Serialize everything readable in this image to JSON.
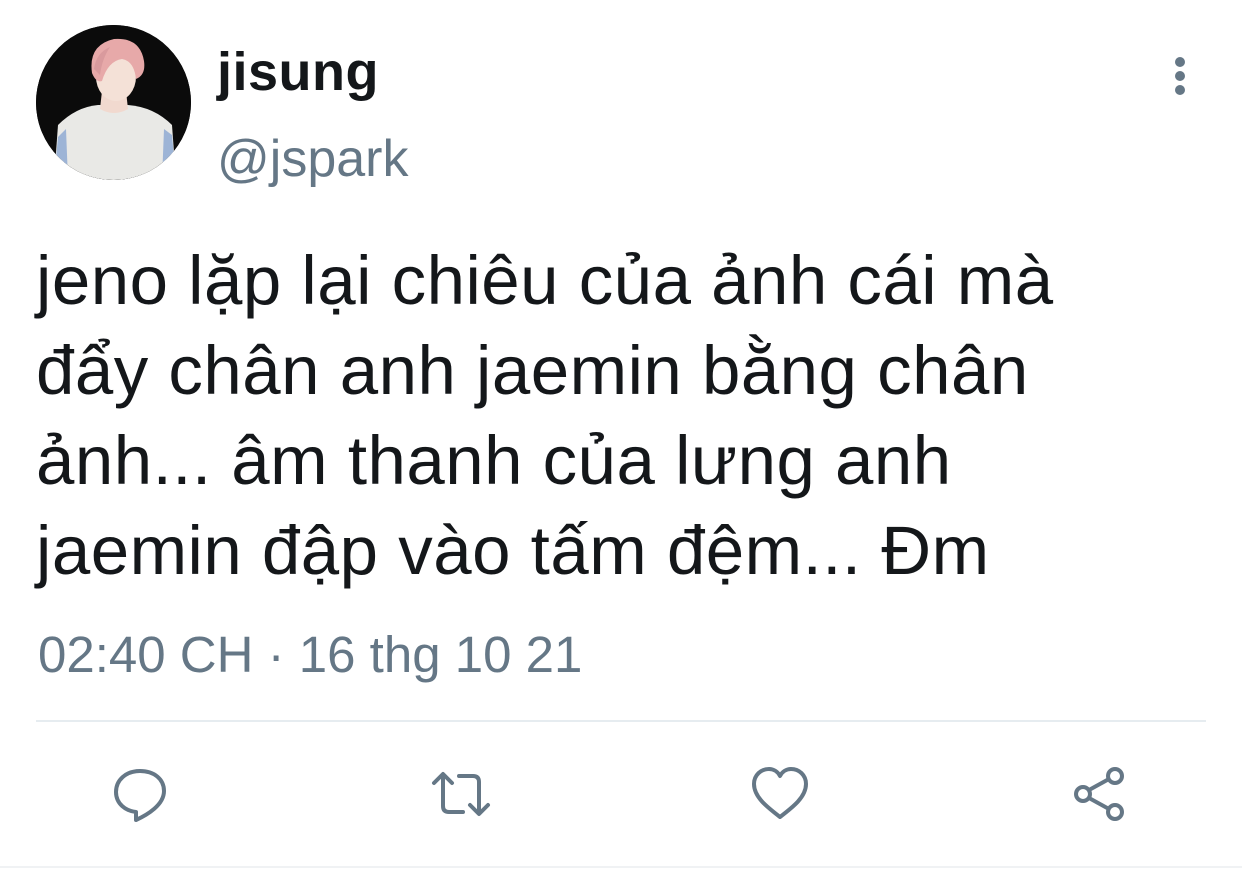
{
  "user": {
    "display_name": "jisung",
    "handle": "@jspark"
  },
  "tweet": {
    "lines": [
      "jeno lặp lại chiêu của ảnh cái mà",
      "đẩy chân anh jaemin bằng chân",
      "ảnh... âm thanh của lưng anh",
      "jaemin đập vào tấm đệm... Đm"
    ],
    "timestamp": "02:40 CH · 16 thg 10 21"
  },
  "icons": {
    "more": "more-vertical-icon",
    "reply": "reply-icon",
    "retweet": "retweet-icon",
    "like": "heart-icon",
    "share": "share-icon"
  },
  "colors": {
    "text": "#14171a",
    "secondary": "#657786",
    "divider": "#e6ecf0"
  }
}
